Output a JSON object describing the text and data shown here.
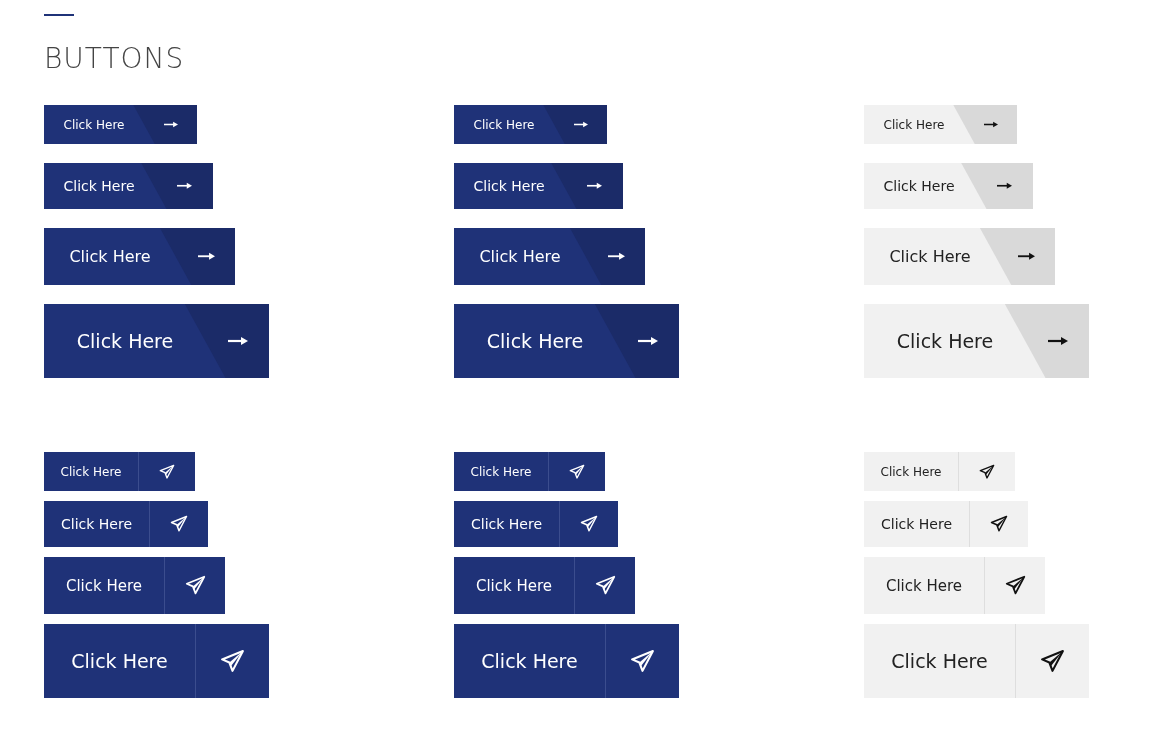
{
  "title": "BUTTONS",
  "groups": [
    {
      "kind": "arrow",
      "columns": [
        {
          "kind": "dark",
          "buttons": [
            "Click Here",
            "Click Here",
            "Click Here",
            "Click Here"
          ]
        },
        {
          "kind": "dark",
          "buttons": [
            "Click Here",
            "Click Here",
            "Click Here",
            "Click Here"
          ]
        },
        {
          "kind": "light",
          "buttons": [
            "Click Here",
            "Click Here",
            "Click Here",
            "Click Here"
          ]
        }
      ]
    },
    {
      "kind": "send",
      "columns": [
        {
          "kind": "dark",
          "buttons": [
            "Click Here",
            "Click Here",
            "Click Here",
            "Click Here"
          ]
        },
        {
          "kind": "dark",
          "buttons": [
            "Click Here",
            "Click Here",
            "Click Here",
            "Click Here"
          ]
        },
        {
          "kind": "light",
          "buttons": [
            "Click Here",
            "Click Here",
            "Click Here",
            "Click Here"
          ]
        }
      ]
    }
  ]
}
